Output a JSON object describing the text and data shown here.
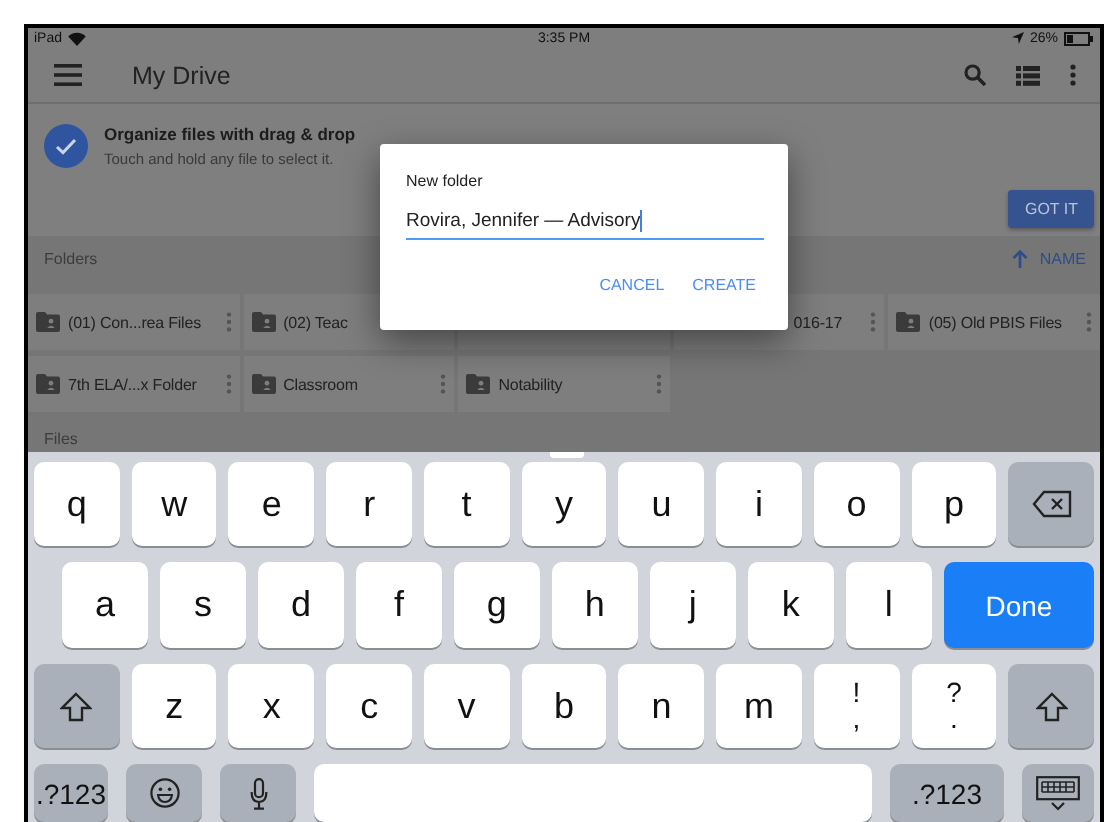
{
  "status_bar": {
    "device": "iPad",
    "time": "3:35 PM",
    "battery": "26%"
  },
  "app_bar": {
    "title": "My Drive"
  },
  "banner": {
    "title": "Organize files with drag & drop",
    "subtitle": "Touch and hold any file to select it.",
    "button": "GOT IT"
  },
  "folders_header": {
    "label": "Folders",
    "sort": "NAME"
  },
  "folders": [
    {
      "kind": "full",
      "name": "(01) Con...rea Files"
    },
    {
      "kind": "cut-right",
      "name": "(02) Teac"
    },
    {
      "kind": "covered"
    },
    {
      "kind": "cut-left",
      "name": "016-17"
    },
    {
      "kind": "full",
      "name": "(05) Old PBIS Files"
    },
    {
      "kind": "full",
      "name": "7th ELA/...x Folder"
    },
    {
      "kind": "full",
      "name": "Classroom"
    },
    {
      "kind": "full",
      "name": "Notability"
    }
  ],
  "files_header": "Files",
  "dialog": {
    "title": "New folder",
    "value": "Rovira, Jennifer — Advisory",
    "buttons": [
      "CANCEL",
      "CREATE"
    ]
  },
  "keyboard": {
    "rows": [
      [
        {
          "kind": "letter",
          "label": "q"
        },
        {
          "kind": "letter",
          "label": "w"
        },
        {
          "kind": "letter",
          "label": "e"
        },
        {
          "kind": "letter",
          "label": "r"
        },
        {
          "kind": "letter",
          "label": "t"
        },
        {
          "kind": "letter",
          "label": "y"
        },
        {
          "kind": "letter",
          "label": "u"
        },
        {
          "kind": "letter",
          "label": "i"
        },
        {
          "kind": "letter",
          "label": "o"
        },
        {
          "kind": "letter",
          "label": "p"
        },
        {
          "kind": "backspace"
        }
      ],
      [
        {
          "kind": "letter",
          "label": "a"
        },
        {
          "kind": "letter",
          "label": "s"
        },
        {
          "kind": "letter",
          "label": "d"
        },
        {
          "kind": "letter",
          "label": "f"
        },
        {
          "kind": "letter",
          "label": "g"
        },
        {
          "kind": "letter",
          "label": "h"
        },
        {
          "kind": "letter",
          "label": "j"
        },
        {
          "kind": "letter",
          "label": "k"
        },
        {
          "kind": "letter",
          "label": "l"
        },
        {
          "kind": "done",
          "label": "Done"
        }
      ],
      [
        {
          "kind": "shift"
        },
        {
          "kind": "letter",
          "label": "z"
        },
        {
          "kind": "letter",
          "label": "x"
        },
        {
          "kind": "letter",
          "label": "c"
        },
        {
          "kind": "letter",
          "label": "v"
        },
        {
          "kind": "letter",
          "label": "b"
        },
        {
          "kind": "letter",
          "label": "n"
        },
        {
          "kind": "letter",
          "label": "m"
        },
        {
          "kind": "punct",
          "top": "!",
          "bottom": ","
        },
        {
          "kind": "punct",
          "top": "?",
          "bottom": "."
        },
        {
          "kind": "shift"
        }
      ]
    ],
    "bottom_row": [
      {
        "kind": "mode",
        "label": ".?123"
      },
      {
        "kind": "emoji"
      },
      {
        "kind": "mic"
      },
      {
        "kind": "space"
      },
      {
        "kind": "mode-wide",
        "label": ".?123"
      },
      {
        "kind": "dismiss"
      }
    ]
  }
}
